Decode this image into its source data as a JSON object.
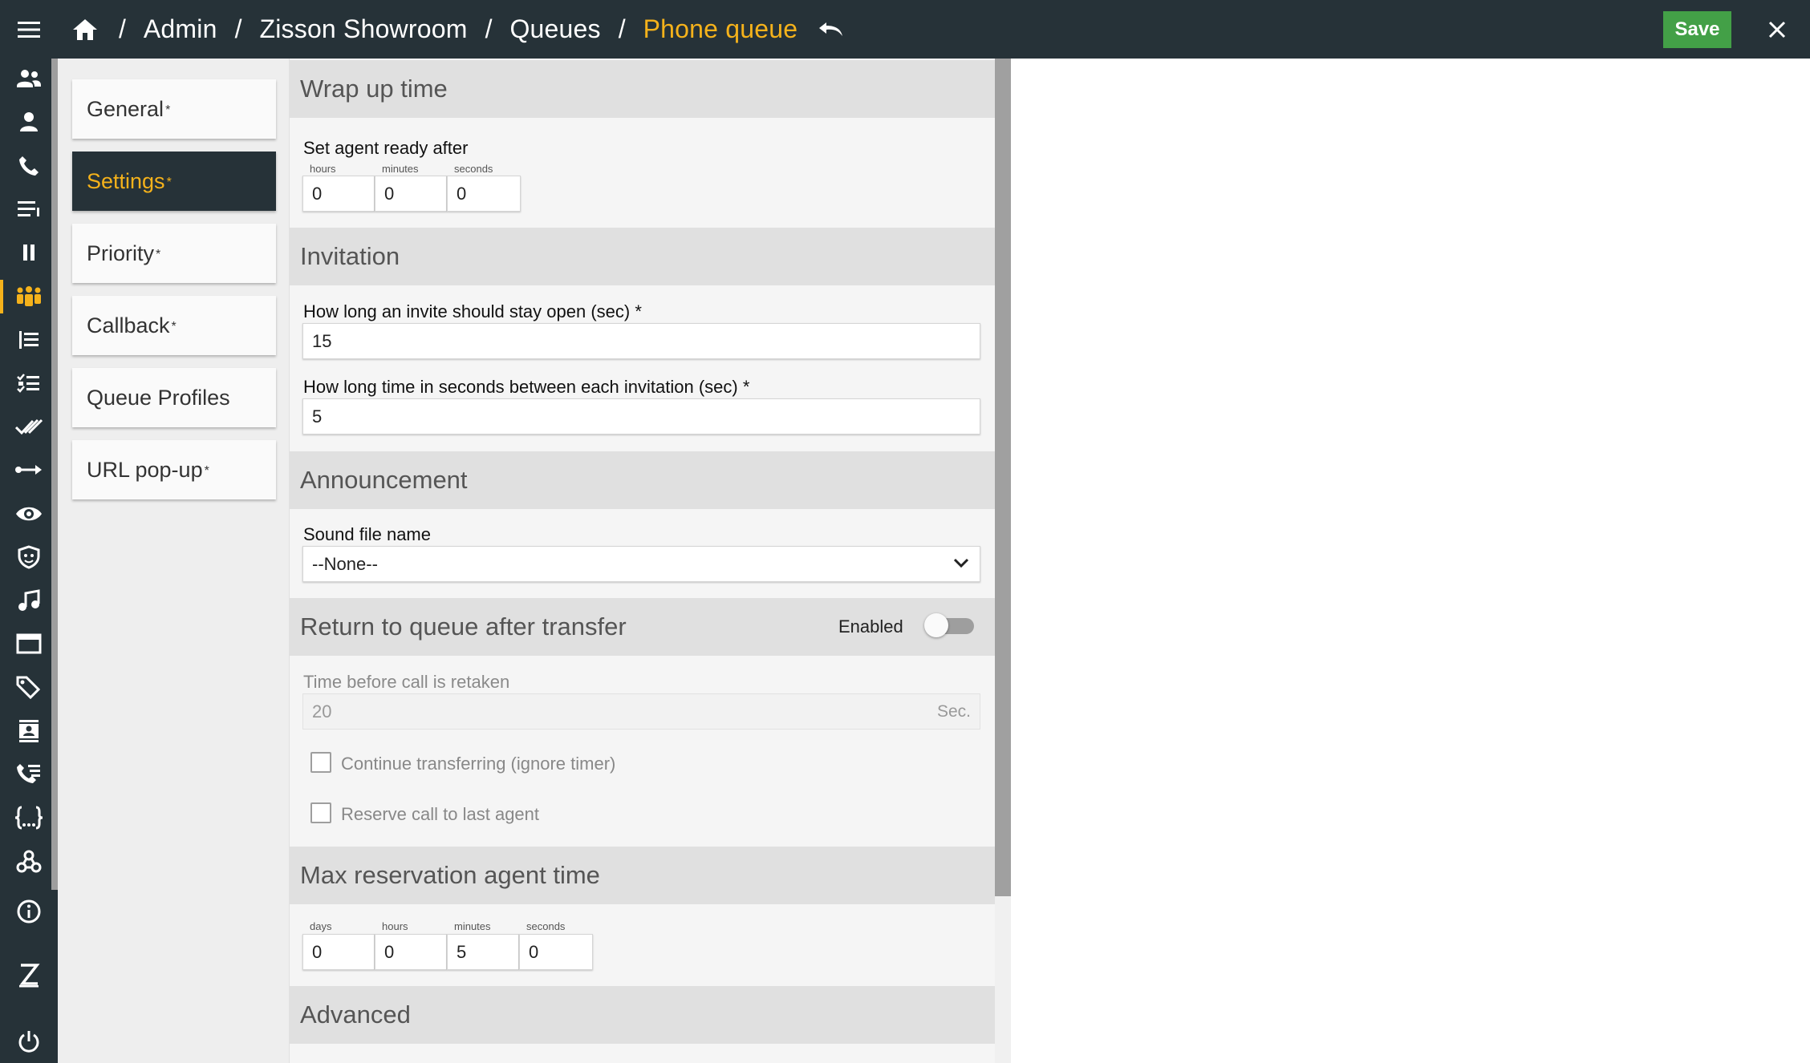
{
  "header": {
    "breadcrumbs": [
      "Admin",
      "Zisson Showroom",
      "Queues",
      "Phone queue"
    ],
    "save_label": "Save"
  },
  "rail": {
    "icons": [
      "agents-icon",
      "user-icon",
      "phone-icon",
      "list-icon",
      "pause-icon",
      "queues-icon",
      "report-icon",
      "checklist-icon",
      "done-all-icon",
      "transfer-icon",
      "eye-icon",
      "shield-icon",
      "music-icon",
      "folder-icon",
      "tags-icon",
      "contact-card-icon",
      "call-log-icon",
      "code-braces-icon",
      "webhook-icon",
      "info-icon",
      "zisson-logo-icon",
      "power-icon"
    ],
    "active": "queues-icon"
  },
  "subnav": {
    "items": [
      {
        "label": "General",
        "star": "*"
      },
      {
        "label": "Settings",
        "star": "*"
      },
      {
        "label": "Priority",
        "star": "*"
      },
      {
        "label": "Callback",
        "star": "*"
      },
      {
        "label": "Queue Profiles",
        "star": ""
      },
      {
        "label": "URL pop-up",
        "star": "*"
      }
    ],
    "active_index": 1
  },
  "form": {
    "wrap_up": {
      "title": "Wrap up time",
      "label": "Set agent ready after",
      "fields": [
        {
          "unit": "hours",
          "value": "0"
        },
        {
          "unit": "minutes",
          "value": "0"
        },
        {
          "unit": "seconds",
          "value": "0"
        }
      ]
    },
    "invitation": {
      "title": "Invitation",
      "open_label": "How long an invite should stay open (sec) *",
      "open_value": "15",
      "between_label": "How long time in seconds between each invitation (sec) *",
      "between_value": "5"
    },
    "announcement": {
      "title": "Announcement",
      "sound_label": "Sound file name",
      "sound_value": "--None--"
    },
    "return_to_queue": {
      "title": "Return to queue after transfer",
      "toggle_label": "Enabled",
      "enabled": false,
      "time_label": "Time before call is retaken",
      "time_value": "20",
      "time_unit": "Sec.",
      "continue_label": "Continue transferring (ignore timer)",
      "continue_checked": false,
      "reserve_label": "Reserve call to last agent",
      "reserve_checked": false
    },
    "max_reservation": {
      "title": "Max reservation agent time",
      "fields": [
        {
          "unit": "days",
          "value": "0"
        },
        {
          "unit": "hours",
          "value": "0"
        },
        {
          "unit": "minutes",
          "value": "5"
        },
        {
          "unit": "seconds",
          "value": "0"
        }
      ]
    },
    "advanced": {
      "title": "Advanced"
    }
  }
}
